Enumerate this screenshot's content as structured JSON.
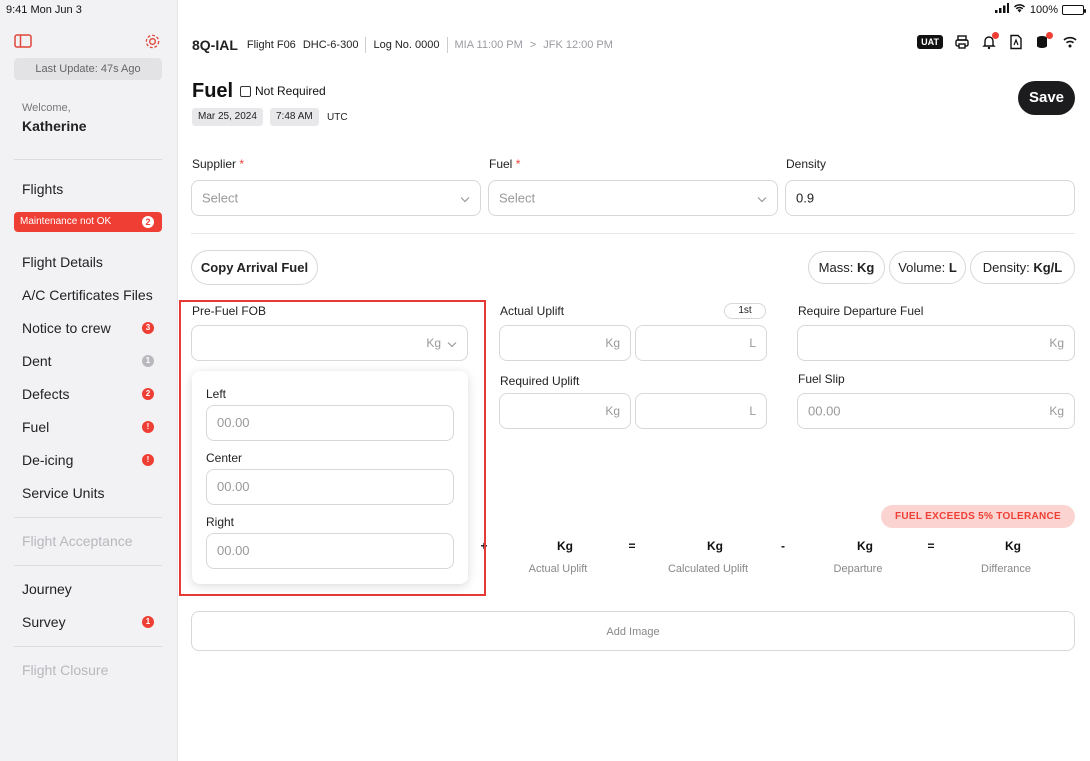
{
  "status_bar": {
    "time": "9:41  Mon Jun 3",
    "battery": "100%"
  },
  "sidebar": {
    "last_update": "Last Update: 47s Ago",
    "welcome": "Welcome,",
    "user": "Katherine",
    "flights": "Flights",
    "maintenance": {
      "label": "Maintenance not OK",
      "count": "2"
    },
    "items": [
      {
        "label": "Flight Details",
        "badge": ""
      },
      {
        "label": "A/C Certificates Files",
        "badge": ""
      },
      {
        "label": "Notice to crew",
        "badge": "3"
      },
      {
        "label": "Dent",
        "badge": "1"
      },
      {
        "label": "Defects",
        "badge": "2"
      },
      {
        "label": "Fuel",
        "badge": "!"
      },
      {
        "label": "De-icing",
        "badge": "!"
      },
      {
        "label": "Service Units",
        "badge": ""
      }
    ],
    "flight_acceptance": "Flight Acceptance",
    "journey": "Journey",
    "survey": {
      "label": "Survey",
      "badge": "1"
    },
    "flight_closure": "Flight Closure"
  },
  "header": {
    "registration": "8Q-IAL",
    "flight": "Flight F06",
    "aircraft": "DHC-6-300",
    "log": "Log No. 0000",
    "route_from": "MIA 11:00 PM",
    "route_sep": ">",
    "route_to": "JFK 12:00 PM",
    "uat": "UAT"
  },
  "page": {
    "title": "Fuel",
    "not_required": "Not Required",
    "date": "Mar 25, 2024",
    "time": "7:48 AM",
    "tz": "UTC",
    "save": "Save"
  },
  "form": {
    "supplier_label": "Supplier",
    "supplier_placeholder": "Select",
    "fuel_label": "Fuel",
    "fuel_placeholder": "Select",
    "required_mark": "*",
    "density_label": "Density",
    "density_value": "0.9",
    "copy_arrival": "Copy Arrival Fuel",
    "units": [
      {
        "label": "Mass:",
        "value": "Kg"
      },
      {
        "label": "Volume:",
        "value": "L"
      },
      {
        "label": "Density:",
        "value": "Kg/L"
      }
    ],
    "prefuel_label": "Pre-Fuel FOB",
    "prefuel_unit": "Kg",
    "actual_uplift_label": "Actual Uplift",
    "actual_uplift_tag": "1st",
    "require_departure_label": "Require Departure Fuel",
    "required_uplift_label": "Required Uplift",
    "fuel_slip_label": "Fuel Slip",
    "fuel_slip_placeholder": "00.00",
    "unit_kg": "Kg",
    "unit_l": "L",
    "tolerance": "FUEL EXCEEDS 5% TOLERANCE",
    "calc": {
      "plus": "+",
      "eq1": "=",
      "minus": "-",
      "eq2": "=",
      "kg": "Kg",
      "labels": [
        "Actual Uplift",
        "Calculated Uplift",
        "Departure",
        "Differance"
      ]
    },
    "add_image": "Add Image"
  },
  "tank_dropdown": {
    "left_label": "Left",
    "center_label": "Center",
    "right_label": "Right",
    "placeholder": "00.00"
  }
}
